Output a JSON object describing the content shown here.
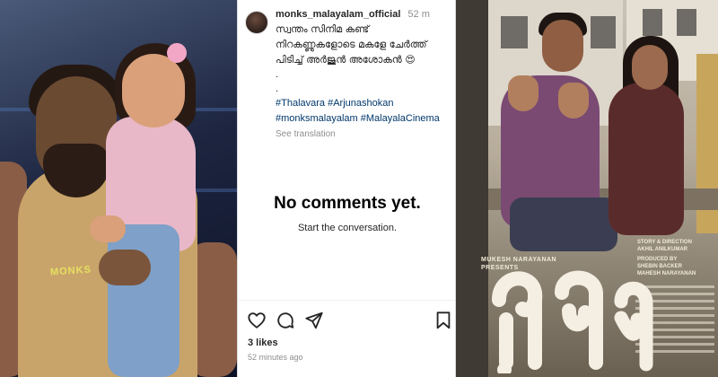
{
  "post": {
    "username": "monks_malayalam_official",
    "time_ago": "52 m",
    "caption": "സ്വന്തം സിനിമ കണ്ട്\nനിറകണ്ണുകളോടെ മകളേ ചേർത്ത്\nപിടിച്ച് അർജുൻ അശോകൻ 😍",
    "dots": [
      ".",
      "."
    ],
    "hashtags_line1": "#Thalavara #Arjunashokan",
    "hashtags_line2": "#monksmalayalam #MalayalaCinema",
    "see_translation": "See translation",
    "likes": "3 likes",
    "post_time": "52 minutes ago"
  },
  "comments": {
    "empty_title": "No comments yet.",
    "empty_subtitle": "Start the conversation."
  },
  "actions": {
    "icons": [
      "heart-icon",
      "comment-icon",
      "share-icon",
      "bookmark-icon"
    ]
  },
  "left_photo": {
    "watermark": "MONKS"
  },
  "poster": {
    "presenter_line1": "MUKESH NARAYANAN",
    "presenter_line2": "PRESENTS",
    "title": "തലവര",
    "credits": [
      "STORY & DIRECTION",
      "AKHIL ANILKUMAR",
      "PRODUCED BY",
      "SHEBIN BACKER",
      "MAHESH NARAYANAN"
    ]
  },
  "colors": {
    "link": "#00376b",
    "text": "#262626",
    "muted": "#8e8e8e"
  }
}
